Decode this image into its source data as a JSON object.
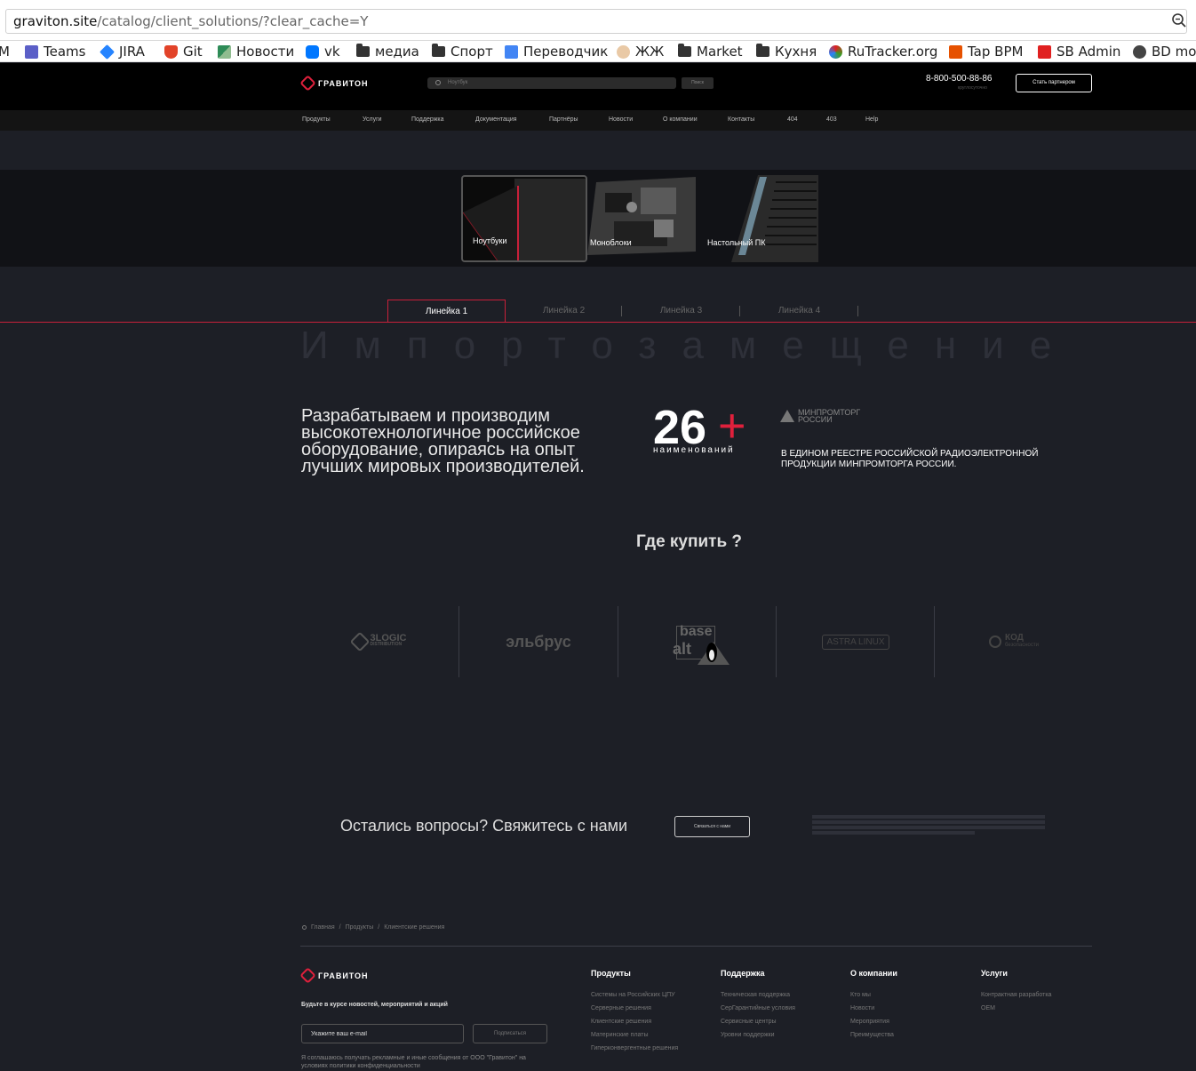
{
  "browser": {
    "url_host": "graviton.site",
    "url_path": "/catalog/client_solutions/?clear_cache=Y",
    "bookmarks": [
      {
        "label": "M",
        "icon": "gmail-icon"
      },
      {
        "label": "Teams",
        "icon": "teams-icon",
        "color": "#5b5fc7"
      },
      {
        "label": "JIRA",
        "icon": "jira-icon",
        "color": "#2684ff"
      },
      {
        "label": "Git",
        "icon": "gitlab-icon",
        "color": "#e24329"
      },
      {
        "label": "Новости",
        "icon": "news-icon",
        "color": "#2e8b57"
      },
      {
        "label": "vk",
        "icon": "vk-icon",
        "color": "#0077ff"
      },
      {
        "label": "медиа",
        "icon": "folder-icon"
      },
      {
        "label": "Спорт",
        "icon": "folder-icon"
      },
      {
        "label": "Переводчик",
        "icon": "translate-icon",
        "color": "#4285f4"
      },
      {
        "label": "ЖЖ",
        "icon": "livejournal-icon"
      },
      {
        "label": "Market",
        "icon": "folder-icon"
      },
      {
        "label": "Кухня",
        "icon": "folder-icon"
      },
      {
        "label": "RuTracker.org",
        "icon": "rutracker-icon",
        "color": "#3a9d23"
      },
      {
        "label": "Tap BPM",
        "icon": "tapbpm-icon",
        "color": "#e65100"
      },
      {
        "label": "SB Admin",
        "icon": "sbadmin-icon",
        "color": "#e02020"
      },
      {
        "label": "BD mo",
        "icon": "globe-icon"
      }
    ]
  },
  "header": {
    "logo_text": "ГРАВИТОН",
    "search_placeholder": "Ноутбук",
    "search_button": "Поиск",
    "phone": "8-800-500-88-86",
    "phone_sub": "круглосуточно",
    "partner_button": "Стать партнером"
  },
  "nav": [
    "Продукты",
    "Услуги",
    "Поддержка",
    "Документация",
    "Партнёры",
    "Новости",
    "О компании",
    "Контакты",
    "404",
    "403",
    "Help"
  ],
  "categories": [
    "Ноутбуки",
    "Моноблоки",
    "Настольный ПК"
  ],
  "tabs": [
    "Линейка 1",
    "Линейка 2",
    "Линейка 3",
    "Линейка 4"
  ],
  "big_title": "Импортозамещение",
  "lead": "Разрабатываем и производим высокотехнологичное российское оборудование, опираясь на опыт лучших мировых производителей.",
  "counter": {
    "number": "26",
    "plus": "+",
    "label": "наименований"
  },
  "minprom": {
    "line1": "МИНПРОМТОРГ",
    "line2": "РОССИИ"
  },
  "reestr": "В ЕДИНОМ РЕЕСТРЕ РОССИЙСКОЙ РАДИОЭЛЕКТРОННОЙ ПРОДУКЦИИ МИНПРОМТОРГА РОССИИ.",
  "where_to_buy": "Где купить ?",
  "partners": [
    {
      "line1": "3LOGIC",
      "line2": "DISTRIBUTION"
    },
    {
      "line1": "эльбрус",
      "line2": ""
    },
    {
      "line1": "base",
      "line2": "alt"
    },
    {
      "line1": "ASTRA LINUX",
      "line2": ""
    },
    {
      "line1": "КОД",
      "line2": "безопасности"
    }
  ],
  "contact": {
    "question": "Остались вопросы? Свяжитесь с нами",
    "button": "Связаться с нами"
  },
  "breadcrumb": [
    "Главная",
    "/",
    "Продукты",
    "/",
    "Клиентские решения"
  ],
  "footer": {
    "logo_text": "ГРАВИТОН",
    "subscribe_title": "Будьте в курсе новостей, мероприятий и акций",
    "email_placeholder": "Укажите ваш e-mail",
    "subscribe_button": "Подписаться",
    "consent": "Я соглашаюсь получать рекламные и иные сообщения от ООО \"Гравитон\" на условиях политики конфиденциальности",
    "columns": [
      {
        "title": "Продукты",
        "items": [
          "Системы на Российских ЦПУ",
          "Серверные решения",
          "Клиентские решения",
          "Материнские платы",
          "Гиперконвергентные решения"
        ]
      },
      {
        "title": "Поддержка",
        "items": [
          "Техническая поддержка",
          "СерГарантийные условия",
          "Сервисные центры",
          "Уровни поддержки"
        ]
      },
      {
        "title": "О компании",
        "items": [
          "Кто мы",
          "Новости",
          "Мероприятия",
          "Преимущества"
        ]
      },
      {
        "title": "Услуги",
        "items": [
          "Контрактная разработка",
          "OEM"
        ]
      }
    ]
  }
}
